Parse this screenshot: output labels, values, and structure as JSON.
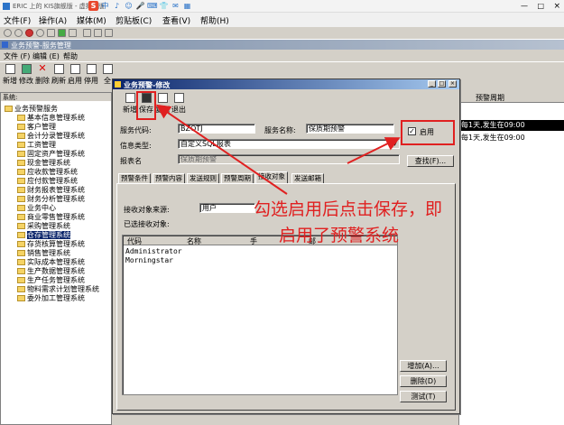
{
  "app": {
    "title": "ERIC 上的 KIS旗舰版 - 虚拟机版",
    "ime_icons": [
      "S",
      "中",
      "♪",
      "☺",
      "🎤",
      "⌨",
      "👕",
      "✉",
      "▦"
    ],
    "window_controls": [
      "—",
      "□",
      "×"
    ]
  },
  "menu": [
    "文件(F)",
    "操作(A)",
    "媒体(M)",
    "剪贴板(C)",
    "查看(V)",
    "帮助(H)"
  ],
  "mdi": {
    "title": "业务预警-服务管理",
    "menu": [
      "文件 (F)",
      "编辑 (E)",
      "帮助"
    ],
    "toolbar": [
      "新增",
      "修改",
      "删除",
      "刷新",
      "启用",
      "停用",
      "全"
    ],
    "tree_header": "系统:",
    "tree": [
      {
        "label": "业务预警服务",
        "level": 0
      },
      {
        "label": "基本信息管理系统",
        "level": 1
      },
      {
        "label": "客户管理",
        "level": 1
      },
      {
        "label": "会计分录管理系统",
        "level": 1
      },
      {
        "label": "工资管理",
        "level": 1
      },
      {
        "label": "固定资产管理系统",
        "level": 1
      },
      {
        "label": "现金管理系统",
        "level": 1
      },
      {
        "label": "应收款管理系统",
        "level": 1
      },
      {
        "label": "应付款管理系统",
        "level": 1
      },
      {
        "label": "财务报表管理系统",
        "level": 1
      },
      {
        "label": "财务分析管理系统",
        "level": 1
      },
      {
        "label": "业务中心",
        "level": 1
      },
      {
        "label": "商业零售管理系统",
        "level": 1
      },
      {
        "label": "采购管理系统",
        "level": 1
      },
      {
        "label": "仓存管理系统",
        "level": 1,
        "selected": true
      },
      {
        "label": "存货核算管理系统",
        "level": 1
      },
      {
        "label": "销售管理系统",
        "level": 1
      },
      {
        "label": "实际成本管理系统",
        "level": 1
      },
      {
        "label": "生产数据管理系统",
        "level": 1
      },
      {
        "label": "生产任务管理系统",
        "level": 1
      },
      {
        "label": "物料需求计划管理系统",
        "level": 1
      },
      {
        "label": "委外加工管理系统",
        "level": 1
      }
    ],
    "grid_header": "预警周期",
    "grid_rows": [
      {
        "text": "每1天,发生在09:00",
        "selected": true
      },
      {
        "text": "每1天,发生在09:00",
        "selected": false
      }
    ]
  },
  "dialog": {
    "title": "业务预警-修改",
    "toolbar": [
      "新增",
      "保存",
      "复制",
      "退出"
    ],
    "service_code_label": "服务代码:",
    "service_code": "BZQTJ",
    "service_name_label": "服务名称:",
    "service_name": "保质期预警",
    "enable_label": "启用",
    "enable_checked": true,
    "info_type_label": "信息类型:",
    "info_type": "自定义SQL报表",
    "report_name_label": "报表名",
    "report_name": "保质期预警",
    "find_button": "查找(F)...",
    "tabs": [
      "预警条件",
      "预警内容",
      "发送规则",
      "预警周期",
      "接收对象",
      "发送邮箱"
    ],
    "active_tab": 4,
    "receiver_source_label": "接收对象来源:",
    "receiver_source": "用户",
    "selected_receivers_label": "已选接收对象:",
    "list_columns": [
      "代码",
      "名称",
      "手",
      "邮"
    ],
    "list_items": [
      "Administrator",
      "Morningstar"
    ],
    "buttons": [
      "增加(A)...",
      "删除(D)",
      "测试(T)"
    ]
  },
  "annotation": {
    "line1": "勾选启用后点击保存，即",
    "line2": "启用了预警系统",
    "color": "#e02020"
  }
}
